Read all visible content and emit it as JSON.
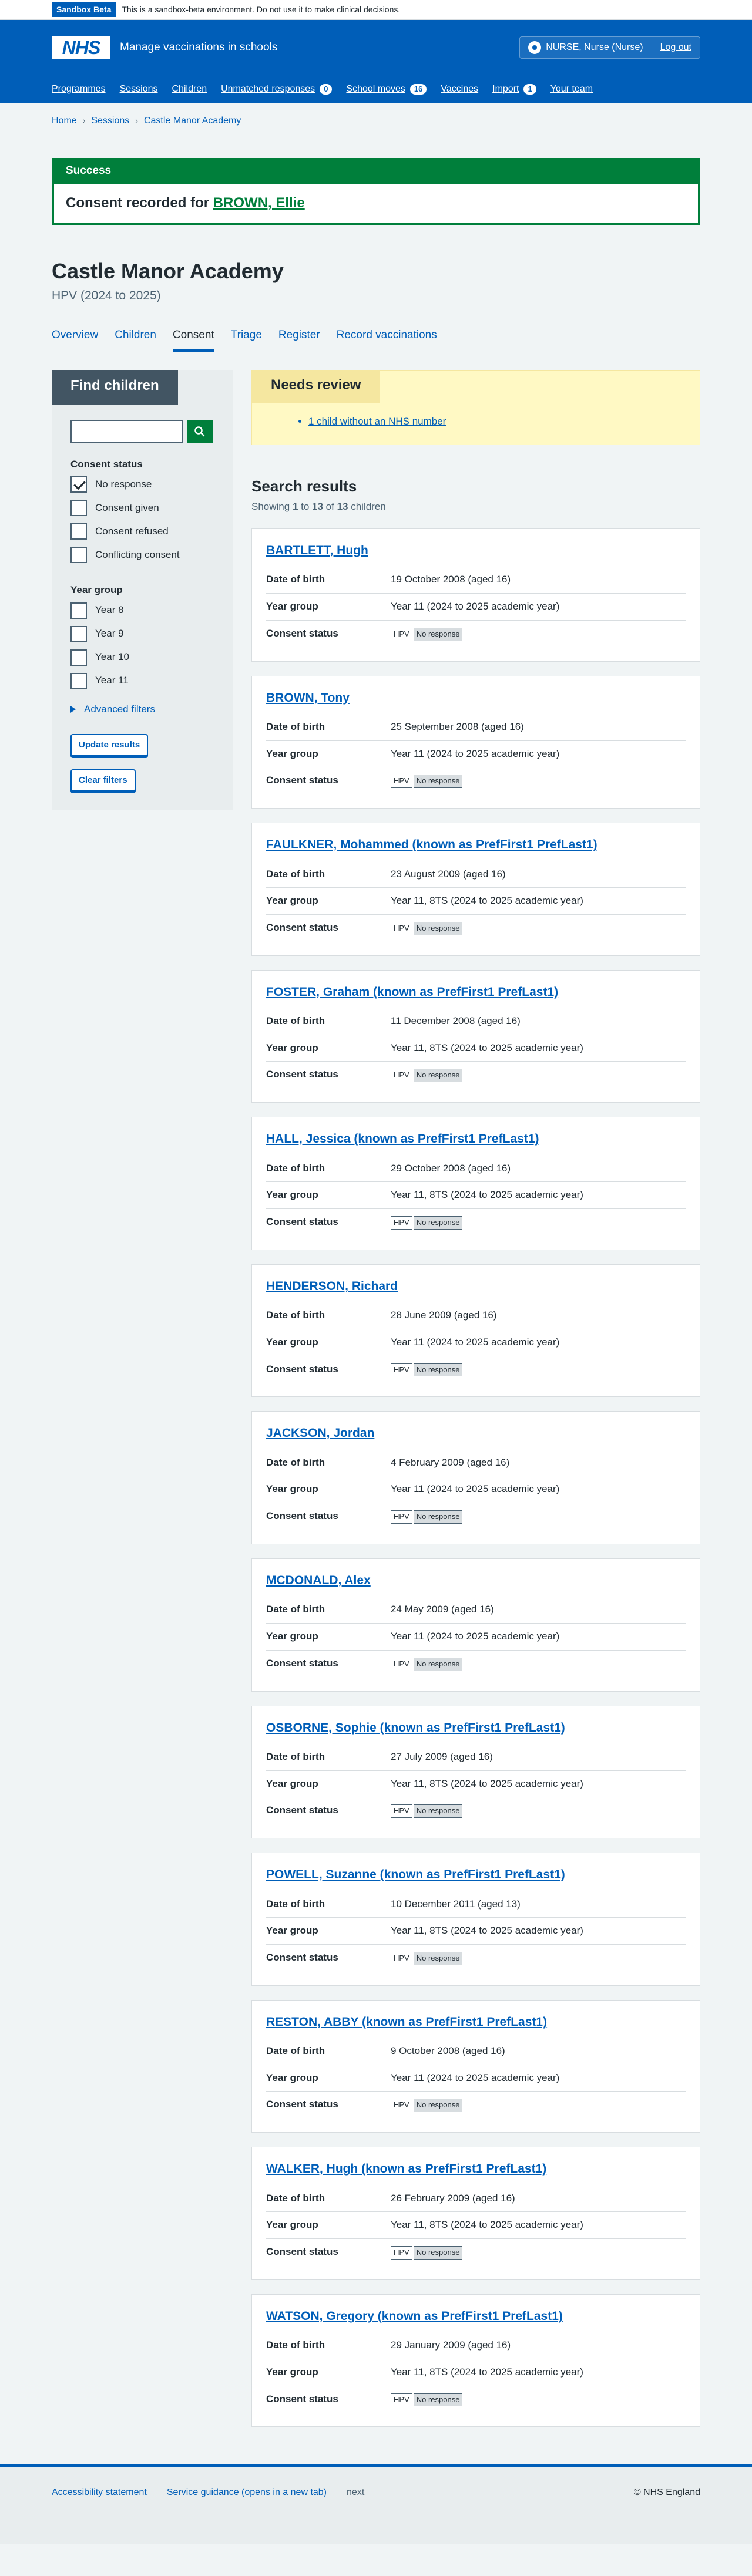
{
  "sandbox": {
    "tag": "Sandbox Beta",
    "text": "This is a sandbox-beta environment. Do not use it to make clinical decisions."
  },
  "header": {
    "logo": "NHS",
    "service_name": "Manage vaccinations in schools",
    "user": "NURSE, Nurse (Nurse)",
    "logout": "Log out",
    "nav": [
      {
        "label": "Programmes"
      },
      {
        "label": "Sessions"
      },
      {
        "label": "Children"
      },
      {
        "label": "Unmatched responses",
        "count": "0"
      },
      {
        "label": "School moves",
        "count": "16"
      },
      {
        "label": "Vaccines"
      },
      {
        "label": "Import",
        "count": "1"
      },
      {
        "label": "Your team"
      }
    ]
  },
  "breadcrumb": [
    "Home",
    "Sessions",
    "Castle Manor Academy"
  ],
  "success": {
    "title": "Success",
    "text": "Consent recorded for ",
    "link": "BROWN, Ellie"
  },
  "page": {
    "title": "Castle Manor Academy",
    "programme": "HPV (2024 to 2025)"
  },
  "tabs": [
    "Overview",
    "Children",
    "Consent",
    "Triage",
    "Register",
    "Record vaccinations"
  ],
  "filter": {
    "title": "Find children",
    "consent_label": "Consent status",
    "consent_options": [
      {
        "label": "No response",
        "checked": true
      },
      {
        "label": "Consent given",
        "checked": false
      },
      {
        "label": "Consent refused",
        "checked": false
      },
      {
        "label": "Conflicting consent",
        "checked": false
      }
    ],
    "year_label": "Year group",
    "year_options": [
      "Year 8",
      "Year 9",
      "Year 10",
      "Year 11"
    ],
    "advanced": "Advanced filters",
    "update": "Update results",
    "clear": "Clear filters"
  },
  "review": {
    "title": "Needs review",
    "item": "1 child without an NHS number"
  },
  "results": {
    "heading": "Search results",
    "showing_prefix": "Showing ",
    "from": "1",
    "to_word": " to ",
    "to": "13",
    "of_word": " of ",
    "total": "13",
    "suffix": " children",
    "labels": {
      "dob": "Date of birth",
      "year": "Year group",
      "consent": "Consent status"
    },
    "children": [
      {
        "name": "BARTLETT, Hugh",
        "dob": "19 October 2008 (aged 16)",
        "year": "Year 11 (2024 to 2025 academic year)",
        "programme": "HPV",
        "status": "No response"
      },
      {
        "name": "BROWN, Tony",
        "dob": "25 September 2008 (aged 16)",
        "year": "Year 11 (2024 to 2025 academic year)",
        "programme": "HPV",
        "status": "No response"
      },
      {
        "name": "FAULKNER, Mohammed (known as PrefFirst1 PrefLast1)",
        "dob": "23 August 2009 (aged 16)",
        "year": "Year 11, 8TS (2024 to 2025 academic year)",
        "programme": "HPV",
        "status": "No response"
      },
      {
        "name": "FOSTER, Graham (known as PrefFirst1 PrefLast1)",
        "dob": "11 December 2008 (aged 16)",
        "year": "Year 11, 8TS (2024 to 2025 academic year)",
        "programme": "HPV",
        "status": "No response"
      },
      {
        "name": "HALL, Jessica (known as PrefFirst1 PrefLast1)",
        "dob": "29 October 2008 (aged 16)",
        "year": "Year 11, 8TS (2024 to 2025 academic year)",
        "programme": "HPV",
        "status": "No response"
      },
      {
        "name": "HENDERSON, Richard",
        "dob": "28 June 2009 (aged 16)",
        "year": "Year 11 (2024 to 2025 academic year)",
        "programme": "HPV",
        "status": "No response"
      },
      {
        "name": "JACKSON, Jordan",
        "dob": "4 February 2009 (aged 16)",
        "year": "Year 11 (2024 to 2025 academic year)",
        "programme": "HPV",
        "status": "No response"
      },
      {
        "name": "MCDONALD, Alex",
        "dob": "24 May 2009 (aged 16)",
        "year": "Year 11 (2024 to 2025 academic year)",
        "programme": "HPV",
        "status": "No response"
      },
      {
        "name": "OSBORNE, Sophie (known as PrefFirst1 PrefLast1)",
        "dob": "27 July 2009 (aged 16)",
        "year": "Year 11, 8TS (2024 to 2025 academic year)",
        "programme": "HPV",
        "status": "No response"
      },
      {
        "name": "POWELL, Suzanne (known as PrefFirst1 PrefLast1)",
        "dob": "10 December 2011 (aged 13)",
        "year": "Year 11, 8TS (2024 to 2025 academic year)",
        "programme": "HPV",
        "status": "No response"
      },
      {
        "name": "RESTON, ABBY (known as PrefFirst1 PrefLast1)",
        "dob": "9 October 2008 (aged 16)",
        "year": "Year 11 (2024 to 2025 academic year)",
        "programme": "HPV",
        "status": "No response"
      },
      {
        "name": "WALKER, Hugh (known as PrefFirst1 PrefLast1)",
        "dob": "26 February 2009 (aged 16)",
        "year": "Year 11, 8TS (2024 to 2025 academic year)",
        "programme": "HPV",
        "status": "No response"
      },
      {
        "name": "WATSON, Gregory (known as PrefFirst1 PrefLast1)",
        "dob": "29 January 2009 (aged 16)",
        "year": "Year 11, 8TS (2024 to 2025 academic year)",
        "programme": "HPV",
        "status": "No response"
      }
    ]
  },
  "footer": {
    "links": [
      "Accessibility statement",
      "Service guidance (opens in a new tab)"
    ],
    "next": "next",
    "copyright": "© NHS England"
  }
}
